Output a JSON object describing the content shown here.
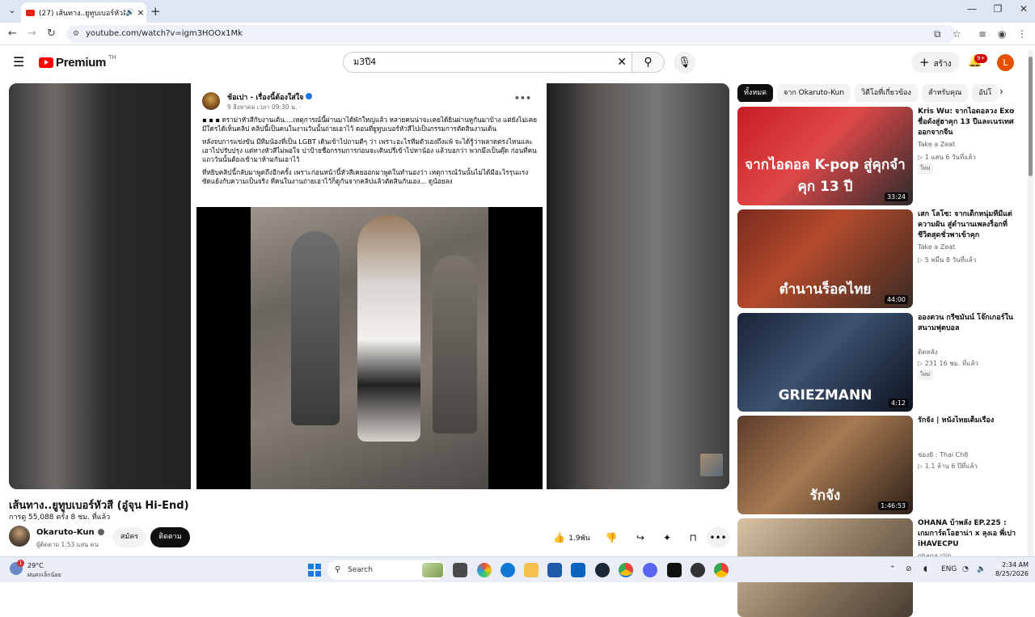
{
  "browser": {
    "tab_title": "(27) เส้นทาง..ยูทูบเบอร์หัวสี (อู๋จุ...",
    "url": "youtube.com/watch?v=igm3HOOx1Mk"
  },
  "header": {
    "logo_text": "Premium",
    "logo_country": "TH",
    "search_value": "ม3ปี4",
    "create_label": "สร้าง",
    "notification_count": "9+",
    "avatar_letter": "L"
  },
  "post": {
    "name": "ช้อเปา - เรื่องนี้ต้องใส่ใจ",
    "date": "9 สิงหาคม เวลา 09:30 น. · ",
    "para1": "▪ ▪ ▪ ดราม่าหัวสีกับงานเต้น....เหตุการณ์นี้ผ่านมาได้พักใหญ่แล้ว หลายคนน่าจะเคยได้ยินผ่านหูกันมาบ้าง แต่ยังไม่เคยมีใครได้เห็นคลิป คลิปนี้เป็นคนในงานวันนั้นถ่ายเอาไว้ ตอนที่ยูทูบเบอร์หัวสีไปเป็นกรรมการตัดสินงานเต้น",
    "para2": "หลังจบการแข่งขัน มีทีมน้องที่เป็น LGBT เดินเข้าไปถามตีๆ ว่า เพราะอะไรทีมตัวเองถึงแพ้ จะได้รู้ว่าพลาดตรงไหนและเอาไปปรับปรุง แต่ทางหัวสีไม่พอใจ ปาป้ายชื่อกรรมการก่อนจะเดินปรี่เข้าไปหาน้อง แล้วบอกว่า พวกมึงเป็นตุ๊ด ก่อนที่คนแถววันนั้นต้องเข้ามาห้ามกันเอาไว้",
    "para3": "ที่หยิบคลิปนี้กลับมาพูดถึงอีกครั้ง เพราะก่อนหน้านี้หัวสีเคยออกมาพูดในทำนองว่า เหตุการณ์วันนั้นไม่ได้มีอะไรรุนแรง ซัดแย้งกับความเป็นจริง ที่คนในงานถ่ายเอาไว้ก็ดูกันจากคลิปแล้วตัดสินกันเอง... ดูน้อยลง"
  },
  "video": {
    "title": "เส้นทาง..ยูทูบเบอร์หัวสี (อู๋จุน Hi-End)",
    "meta": "การดู 55,088 ครั้ง  8 ชม. ที่แล้ว",
    "channel": "Okaruto-Kun",
    "subs": "ผู้ติดตาม 1.53 แสน คน",
    "join": "สมัคร",
    "subscribe": "ติดตาม",
    "likes": "1.9พัน"
  },
  "chips": [
    "ทั้งหมด",
    "จาก Okaruto-Kun",
    "วิดีโอที่เกี่ยวข้อง",
    "สำหรับคุณ",
    "อัปโ"
  ],
  "recs": [
    {
      "title": "Kris Wu: จากไอดอลวง Exo ชื่อดังสู่ฮาคุก 13 ปีและเนรเทศออกจากจีน",
      "channel": "Take a Zeat",
      "stats": "▷ 1 แสน  6 วันที่แล้ว",
      "new": "ใหม่",
      "duration": "33:24",
      "caption": "จากไอดอล K-pop สู่คุกจำคุก 13 ปี",
      "bg": "linear-gradient(135deg,#c81d25 0%,#e04848 45%,#2b2b2b 100%)"
    },
    {
      "title": "เสก โลโซ: จากเด็กหนุ่มที่มีแต่ความฝัน สู่ตำนานเพลงร็อกที่ชีวิตสุดชั่วพาเข้าคุก",
      "channel": "Take a Zeat",
      "stats": "▷ 5 หมื่น  8 วันที่แล้ว",
      "new": "",
      "duration": "44:00",
      "caption": "ตำนานร็อคไทย",
      "bg": "linear-gradient(135deg,#7a2a1e 0%,#b44a2c 40%,#3a2a22 100%)"
    },
    {
      "title": "อองตวน กรีซมันน์ โจ๊กเกอร์ในสนามฟุตบอล",
      "channel": "ติดหลัง",
      "stats": "▷ 231  16 ชม. ที่แล้ว",
      "new": "ใหม่",
      "duration": "4:12",
      "caption": "GRIEZMANN",
      "bg": "linear-gradient(135deg,#1b2438 0%,#3c5270 45%,#0d1220 100%)"
    },
    {
      "title": "รักจัง | หนังไทยเต็มเรื่อง",
      "channel": "ช่อง8 : Thai Ch8",
      "stats": "▷ 1.1 ล้าน  6 ปีที่แล้ว",
      "new": "",
      "duration": "1:46:53",
      "caption": "รักจัง",
      "bg": "linear-gradient(135deg,#5b3b2a 0%,#a77a52 45%,#2e2018 100%)"
    },
    {
      "title": "OHANA บ้าพลัง EP.225 : เกมการ์ดโอฮาน่า x ลุงเอ พี่เปา iHAVECPU",
      "channel": "ohana clip",
      "stats": "",
      "new": "",
      "duration": "",
      "caption": "",
      "bg": "linear-gradient(135deg,#d8c3a4 0%,#8f7a62 50%,#4a3e33 100%)"
    }
  ],
  "taskbar": {
    "temp": "29°C",
    "weather_desc": "ฝนตกเล็กน้อย",
    "weather_badge": "1",
    "search": "Search",
    "lang": "ENG",
    "time": "2:34 AM",
    "date": "8/25/2026"
  },
  "colors": {
    "brand": "#ff0000",
    "chip_active": "#0f0f0f",
    "taskbar": "#e9eef6"
  }
}
